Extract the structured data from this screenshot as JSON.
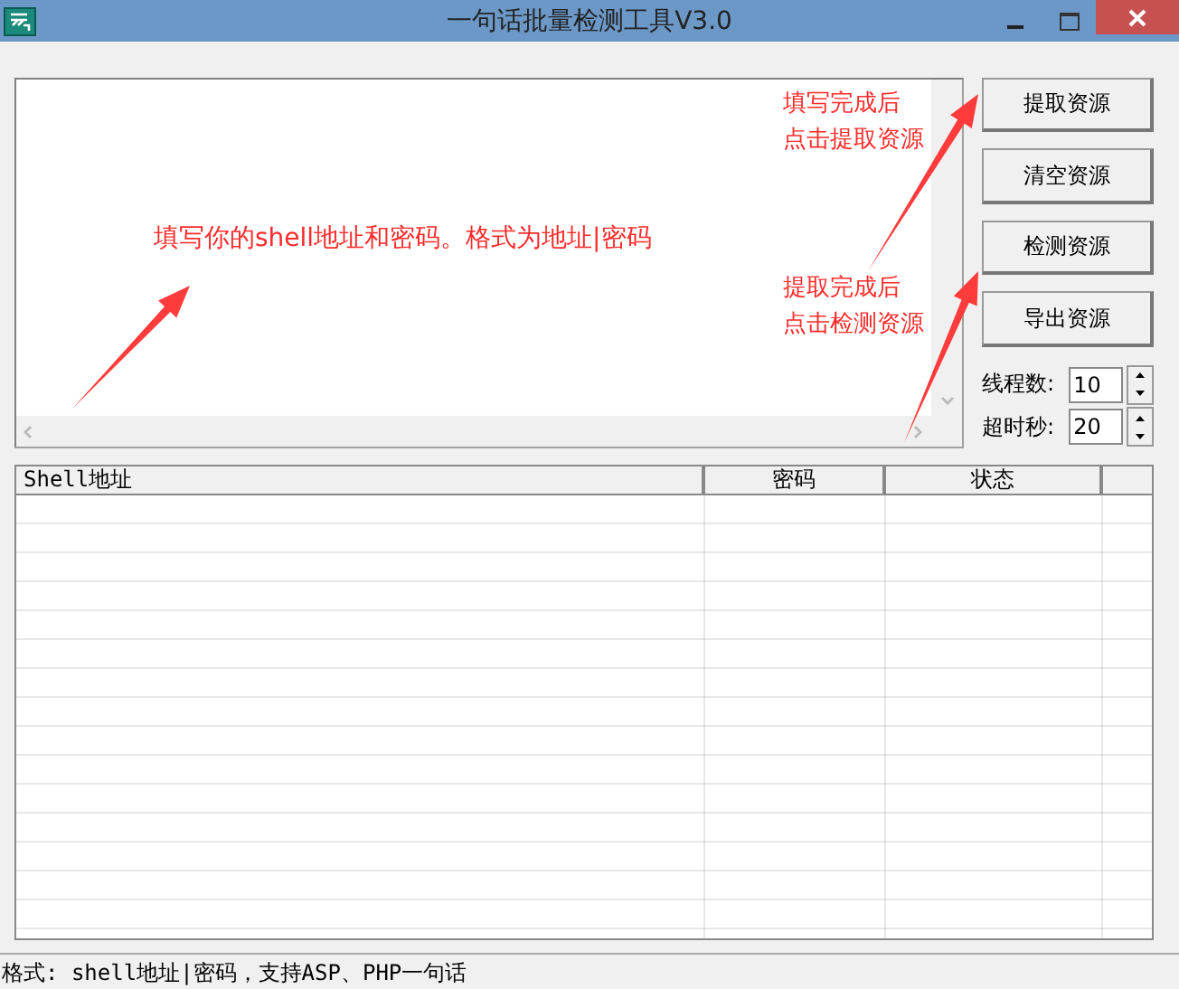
{
  "window": {
    "title": "一句话批量检测工具V3.0"
  },
  "buttons": [
    {
      "label": "提取资源"
    },
    {
      "label": "清空资源"
    },
    {
      "label": "检测资源"
    },
    {
      "label": "导出资源"
    }
  ],
  "settings": [
    {
      "label": "线程数:",
      "value": "10"
    },
    {
      "label": "超时秒:",
      "value": "20"
    }
  ],
  "table": {
    "columns": [
      "Shell地址",
      "密码",
      "状态"
    ]
  },
  "status_bar": "格式: shell地址|密码，支持ASP、PHP一句话",
  "annotations": [
    {
      "lines": [
        "填写你的shell地址和密码。格式为地址|密码"
      ]
    },
    {
      "lines": [
        "填写完成后",
        "点击提取资源"
      ]
    },
    {
      "lines": [
        "提取完成后",
        "点击检测资源"
      ]
    }
  ]
}
